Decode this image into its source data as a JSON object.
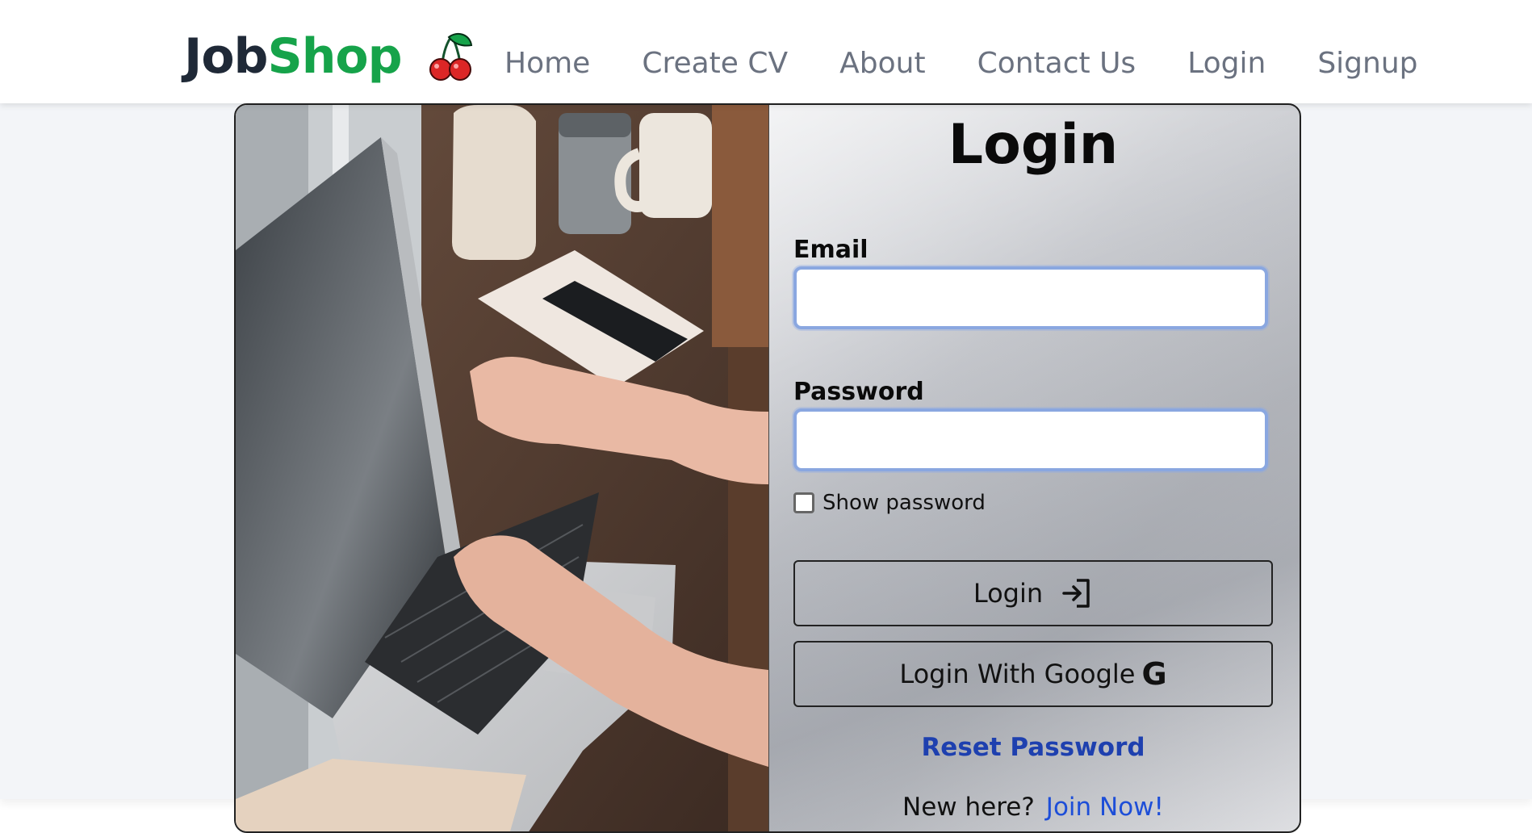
{
  "navbar": {
    "brand_part1": "Job",
    "brand_part2": "Shop",
    "brand_icon": "cherry-icon",
    "links": [
      "Home",
      "Create CV",
      "About",
      "Contact Us",
      "Login",
      "Signup"
    ]
  },
  "login_form": {
    "title": "Login",
    "email_label": "Email",
    "email_value": "",
    "password_label": "Password",
    "password_value": "",
    "show_password_label": "Show password",
    "show_password_checked": false,
    "login_button_label": "Login",
    "login_button_icon": "sign-in-icon",
    "google_button_label": "Login With Google",
    "google_button_icon": "google-g-icon",
    "reset_password_label": "Reset Password",
    "new_here_text": "New here?",
    "join_now_label": "Join Now!"
  },
  "colors": {
    "brand_dark": "#1f2937",
    "brand_green": "#16a34a",
    "nav_text": "#6b7280",
    "input_focus_border": "#8aa7e0",
    "reset_link": "#1e40af",
    "join_link": "#1d4ed8",
    "page_background": "#f3f5f8"
  }
}
